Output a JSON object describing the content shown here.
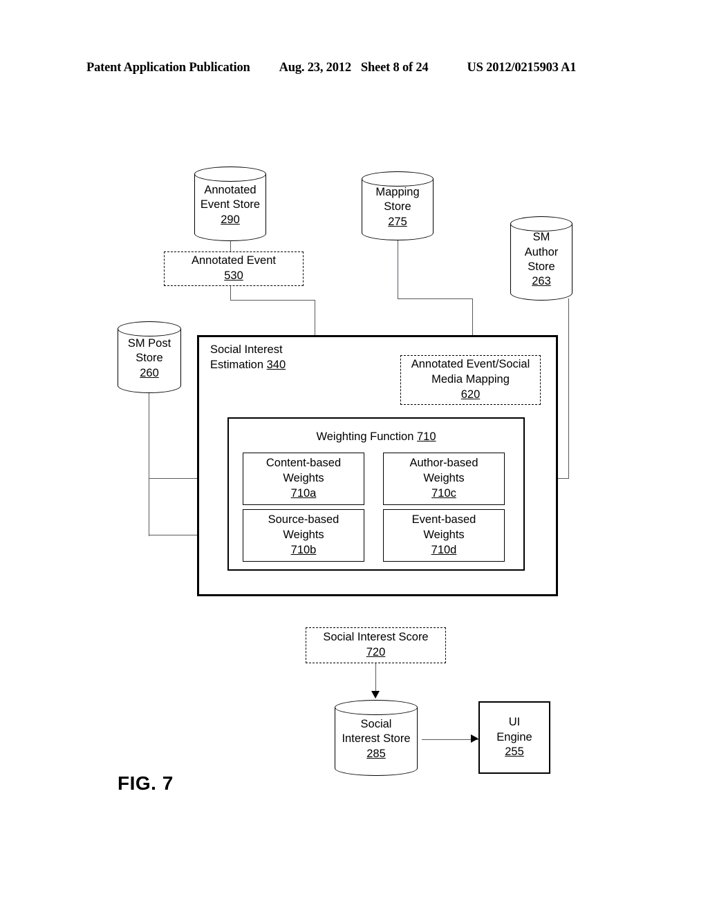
{
  "header": {
    "publication": "Patent Application Publication",
    "date": "Aug. 23, 2012",
    "sheet": "Sheet 8 of 24",
    "patent_number": "US 2012/0215903 A1"
  },
  "figure": {
    "label": "FIG. 7"
  },
  "nodes": {
    "annotated_event_store": {
      "line1": "Annotated",
      "line2": "Event Store",
      "ref": "290"
    },
    "mapping_store": {
      "line1": "Mapping",
      "line2": "Store",
      "ref": "275"
    },
    "sm_author_store": {
      "line1": "SM",
      "line2": "Author",
      "line3": "Store",
      "ref": "263"
    },
    "sm_post_store": {
      "line1": "SM Post",
      "line2": "Store",
      "ref": "260"
    },
    "annotated_event": {
      "line1": "Annotated Event",
      "ref": "530"
    },
    "social_interest_estimation": {
      "line1": "Social Interest",
      "line2": "Estimation",
      "ref": "340"
    },
    "annotated_event_social_media_mapping": {
      "line1": "Annotated Event/Social",
      "line2": "Media Mapping",
      "ref": "620"
    },
    "weighting_function": {
      "label": "Weighting Function",
      "ref": "710"
    },
    "content_based_weights": {
      "line1": "Content-based",
      "line2": "Weights",
      "ref": "710a"
    },
    "author_based_weights": {
      "line1": "Author-based",
      "line2": "Weights",
      "ref": "710c"
    },
    "source_based_weights": {
      "line1": "Source-based",
      "line2": "Weights",
      "ref": "710b"
    },
    "event_based_weights": {
      "line1": "Event-based",
      "line2": "Weights",
      "ref": "710d"
    },
    "social_interest_score": {
      "line1": "Social Interest Score",
      "ref": "720"
    },
    "social_interest_store": {
      "line1": "Social",
      "line2": "Interest Store",
      "ref": "285"
    },
    "ui_engine": {
      "line1": "UI",
      "line2": "Engine",
      "ref": "255"
    }
  }
}
